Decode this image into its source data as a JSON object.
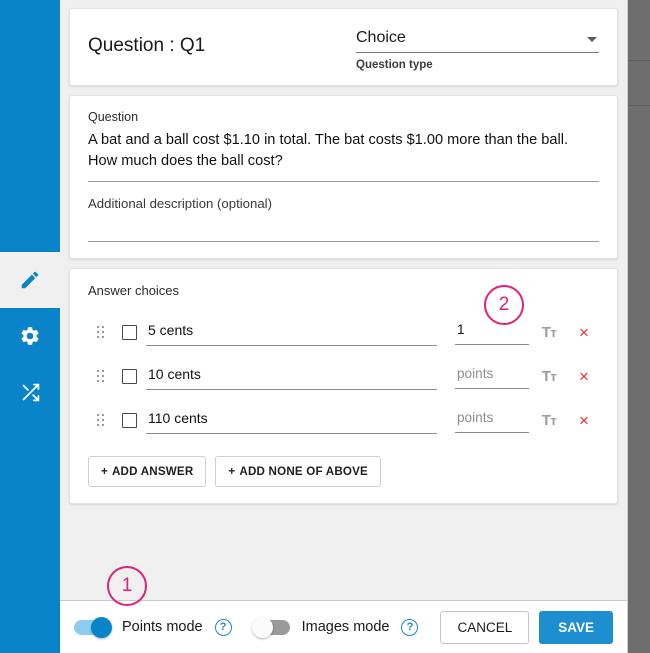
{
  "sidebar": {
    "items": [
      {
        "icon": "pencil-icon",
        "active": true
      },
      {
        "icon": "gear-icon",
        "active": false
      },
      {
        "icon": "shuffle-icon",
        "active": false
      }
    ]
  },
  "header": {
    "question_title": "Question : Q1",
    "question_type_value": "Choice",
    "question_type_label": "Question type",
    "caret_icon": "chevron-down-icon"
  },
  "question": {
    "label": "Question",
    "text": "A bat and a ball cost $1.10 in total. The bat costs $1.00 more than the ball. How much does the ball cost?",
    "description_placeholder": "Additional description (optional)"
  },
  "answers": {
    "section_title": "Answer choices",
    "choices": [
      {
        "label": "5 cents",
        "points": "1",
        "points_is_placeholder": false,
        "checked": false
      },
      {
        "label": "10 cents",
        "points": "points",
        "points_is_placeholder": true,
        "checked": false
      },
      {
        "label": "110 cents",
        "points": "points",
        "points_is_placeholder": true,
        "checked": false
      }
    ],
    "points_placeholder": "points",
    "add_answer_label": "ADD ANSWER",
    "add_none_label": "ADD NONE OF ABOVE",
    "plus_glyph": "+",
    "format_icon_label": "Tt",
    "delete_glyph": "×"
  },
  "footer": {
    "points_mode_label": "Points mode",
    "points_mode_on": true,
    "images_mode_label": "Images mode",
    "images_mode_on": false,
    "help_glyph": "?",
    "cancel_label": "CANCEL",
    "save_label": "SAVE"
  },
  "annotations": [
    {
      "id": "1",
      "text": "1"
    },
    {
      "id": "2",
      "text": "2"
    }
  ],
  "colors": {
    "sidebar_blue": "#0a84c8",
    "save_blue": "#1d8fd1",
    "annotation_pink": "#e0217a",
    "delete_red": "#e03030",
    "backdrop_gray": "#6e6e6e"
  }
}
